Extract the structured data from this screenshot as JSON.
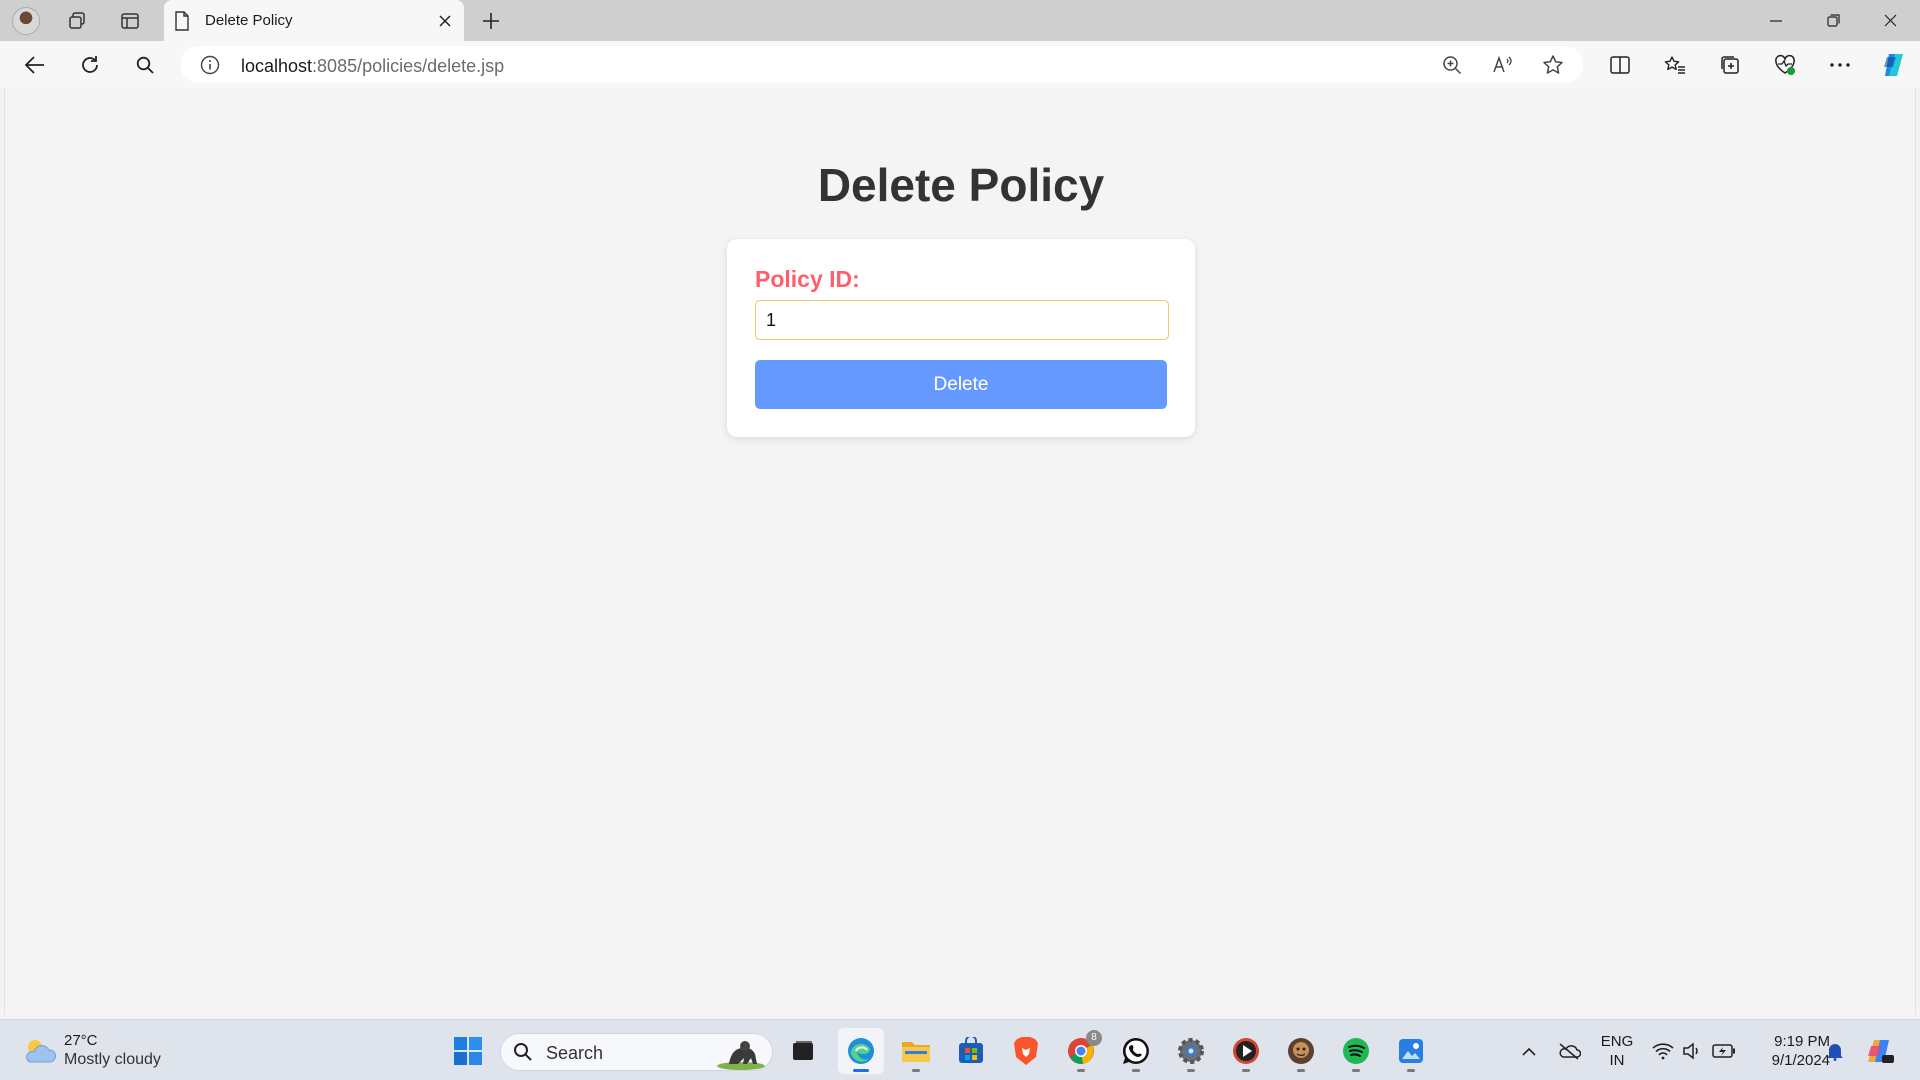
{
  "browser": {
    "tab_title": "Delete Policy",
    "url_host": "localhost",
    "url_path": ":8085/policies/delete.jsp"
  },
  "page": {
    "heading": "Delete Policy",
    "field_label": "Policy ID:",
    "field_value": "1",
    "button_label": "Delete",
    "colors": {
      "label": "#ff5e6b",
      "button": "#6699ff",
      "field_border": "#e9c56e",
      "heading": "#333333"
    }
  },
  "taskbar": {
    "weather_temp": "27°C",
    "weather_condition": "Mostly cloudy",
    "search_label": "Search",
    "lang_line1": "ENG",
    "lang_line2": "IN",
    "time": "9:19 PM",
    "date": "9/1/2024",
    "chrome_badge": "8",
    "apps": [
      "start-icon",
      "task-view-icon",
      "edge-icon",
      "file-explorer-icon",
      "store-icon",
      "brave-icon",
      "chrome-icon",
      "whatsapp-icon",
      "settings-icon",
      "media-player-icon",
      "game-icon",
      "spotify-icon",
      "photos-icon"
    ]
  }
}
